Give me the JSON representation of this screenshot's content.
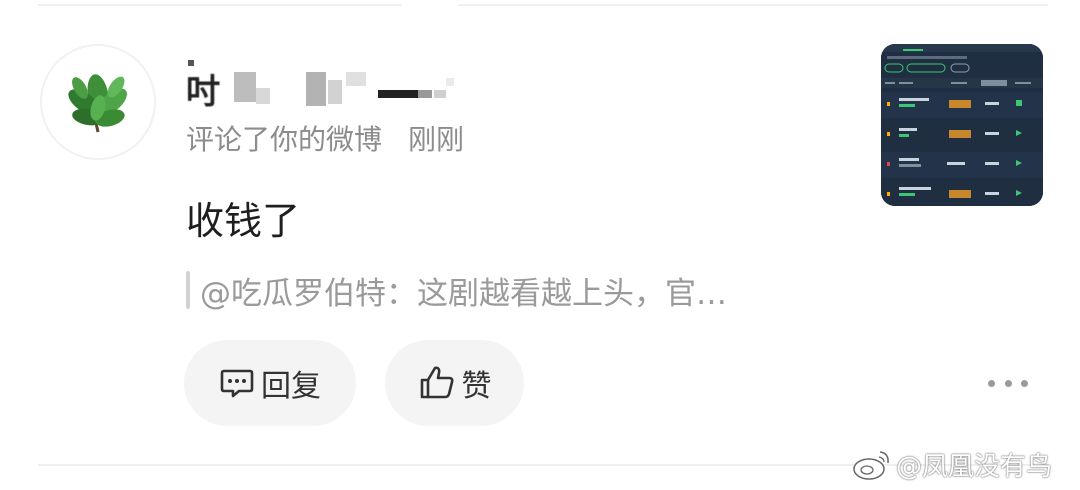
{
  "comment": {
    "username_visible": "吋",
    "action": "评论了你的微博",
    "time": "刚刚",
    "text": "收钱了",
    "quote": "@吃瓜罗伯特：这剧越看越上头，官…"
  },
  "actions": {
    "reply_label": "回复",
    "like_label": "赞"
  },
  "icons": {
    "reply": "comment-bubble-icon",
    "like": "thumbs-up-icon",
    "more": "more-dots-icon",
    "watermark": "weibo-logo-icon"
  },
  "watermark": {
    "text": "@凤凰没有鸟"
  },
  "colors": {
    "text_primary": "#1e1e1e",
    "text_secondary": "#8c8c8c",
    "pill_bg": "#f4f4f4",
    "thumb_bg": "#1f2e40",
    "thumb_accent": "#3cc873"
  }
}
